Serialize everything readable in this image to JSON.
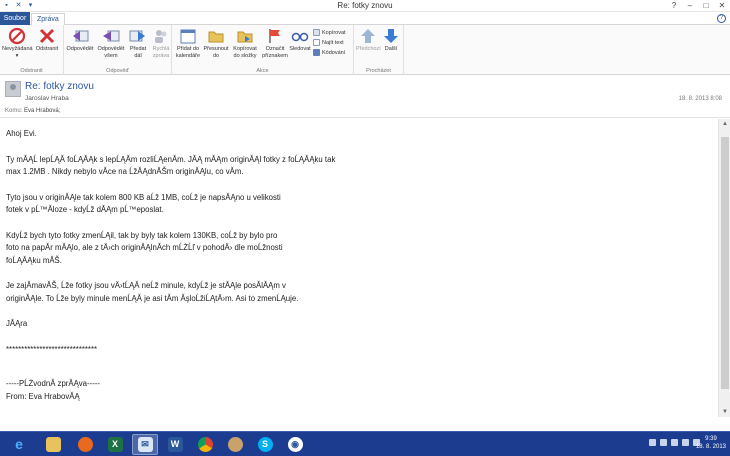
{
  "window": {
    "title": "Re: fotky znovu"
  },
  "tabs": {
    "file": "Soubor",
    "message": "Zpráva"
  },
  "ribbon": {
    "delete_group": {
      "label": "Odstranit",
      "junk": "Nevyžádaná",
      "delete": "Odstranit"
    },
    "respond_group": {
      "label": "Odpověď",
      "reply": "Odpovědět",
      "reply_all": "Odpovědět všem",
      "forward": "Předat dál",
      "quick_reply": "Rychlá zpráva"
    },
    "actions_group": {
      "label": "Akce",
      "add_calendar": "Přidat do kalendáře",
      "move_to": "Přesunout do",
      "copy_to_folder": "Kopírovat do složky",
      "mark": "Označit příznakem",
      "watch": "Sledovat",
      "copy": "Kopírovat",
      "find_text": "Najít text",
      "encoding": "Kódování"
    },
    "navigate_group": {
      "label": "Procházet",
      "previous": "Předchozí",
      "next": "Další"
    }
  },
  "header": {
    "subject": "Re: fotky znovu",
    "sender": "Jaroslav Hraba",
    "date": "18. 8. 2013 8:08",
    "to_label": "Komu:",
    "to_value": "Eva Hrabová;"
  },
  "body": {
    "paragraphs": [
      "Ahoj Evi.",
      "",
      "Ty mĂĄĹ lepĹĄĂ foĹĄĂĄk s lepĹĄĂm rozliĹĄenĂm. JĂĄ mĂĄm originĂĄl fotky z foĹĄĂĄku tak\nmax 1.2MB .  Nikdy nebylo vĂce na ĹžĂĄdnĂŠm originĂĄlu, co vĂm.",
      "Tyto jsou v originĂĄle tak kolem 800 KB aĹž 1MB, coĹž je napsĂĄno u velikosti\nfotek v pĹ™Ăloze - kdyĹž dĂĄm pĹ™eposlat.",
      "KdyĹž bych tyto fotky zmenĹĄil, tak by byly tak kolem 130KB, coĹž by bylo pro\nfoto na papĂr mĂĄlo, ale z tÄ›ch originĂĄlnĂch mĹŻĹľ v pohodÄ› dle moĹžnosti\nfoĹĄĂĄku mĂŠ.",
      "Je zajĂmavĂŠ, Ĺže fotky jsou vÄ›tĹĄĂ neĹž minule, kdyĹž je stĂĄle posĂlĂĄm v\noriginĂĄle. To Ĺže byly minule menĹĄĂ je asi tĂm ĂşloĹžiĹĄtÄ›m. Asi to zmenĹĄuje.",
      "JĂĄra",
      "******************************",
      "",
      "-----PĹŻvodnĂ zprĂĄva-----\nFrom: Eva HrabovĂĄ"
    ]
  },
  "taskbar": {
    "apps": [
      "internet-explorer",
      "file-explorer",
      "firefox",
      "excel",
      "windows-live-mail",
      "word",
      "chrome",
      "paint",
      "skype",
      "outlook"
    ],
    "clock_time": "9:39",
    "clock_date": "18. 8. 2013"
  },
  "colors": {
    "accent": "#2b579a",
    "taskbar": "#1c3d8f"
  }
}
